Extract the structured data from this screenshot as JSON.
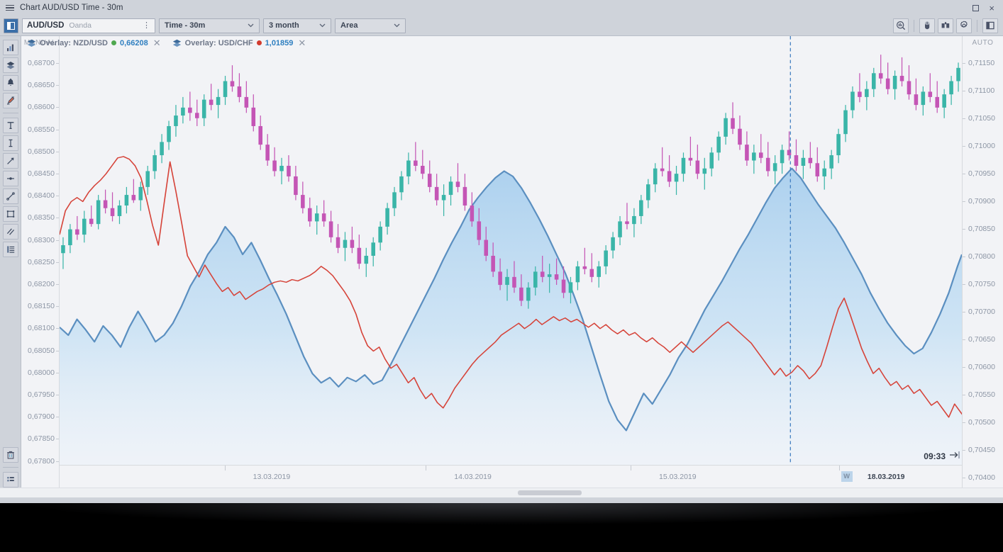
{
  "window": {
    "title": "Chart AUD/USD Time - 30m",
    "menu_icon": "hamburger-icon",
    "maximize_label": "",
    "close_label": "×"
  },
  "toolbar": {
    "panel_toggle_icon": "panel-toggle-icon",
    "symbol": {
      "name": "AUD/USD",
      "source": "Oanda",
      "more_icon": "more-vertical-icon"
    },
    "timeframe": {
      "label": "Time - 30m"
    },
    "range": {
      "label": "3 month"
    },
    "chart_type": {
      "label": "Area"
    },
    "right_buttons": [
      {
        "name": "zoom-mode-icon"
      },
      {
        "name": "mouse-mode-icon"
      },
      {
        "name": "compare-icon"
      },
      {
        "name": "settings-gear-icon"
      },
      {
        "name": "right-panel-icon"
      }
    ]
  },
  "rail": {
    "items": [
      {
        "name": "bar-chart-icon"
      },
      {
        "name": "layers-icon"
      },
      {
        "name": "alert-bell-icon"
      },
      {
        "name": "draw-pencil-icon"
      },
      {
        "name": "text-tool-icon"
      },
      {
        "name": "vertical-line-icon"
      },
      {
        "name": "arrow-tool-icon"
      },
      {
        "name": "horizontal-ray-icon"
      },
      {
        "name": "trend-line-icon"
      },
      {
        "name": "rectangle-icon"
      },
      {
        "name": "parallel-channel-icon"
      },
      {
        "name": "fibonacci-icon"
      }
    ],
    "bottom_items": [
      {
        "name": "trash-icon"
      },
      {
        "name": "objects-list-icon"
      }
    ]
  },
  "overlays": [
    {
      "label": "Overlay: NZD/USD",
      "value": "0,66208",
      "color": "#4fa84f",
      "close_label": "✕",
      "icon": "layers-icon"
    },
    {
      "label": "Overlay: USD/CHF",
      "value": "1,01859",
      "color": "#d23b2e",
      "close_label": "✕",
      "icon": "layers-icon"
    }
  ],
  "axes": {
    "left": {
      "mode_label": "MANUAL",
      "ticks": [
        "0,68700",
        "0,68650",
        "0,68600",
        "0,68550",
        "0,68500",
        "0,68450",
        "0,68400",
        "0,68350",
        "0,68300",
        "0,68250",
        "0,68200",
        "0,68150",
        "0,68100",
        "0,68050",
        "0,68000",
        "0,67950",
        "0,67900",
        "0,67850",
        "0,67800"
      ]
    },
    "right": {
      "mode_label": "AUTO",
      "ticks": [
        "0,71150",
        "0,71100",
        "0,71050",
        "0,71000",
        "0,70950",
        "0,70900",
        "0,70850",
        "0,70800",
        "0,70750",
        "0,70700",
        "0,70650",
        "0,70600",
        "0,70550",
        "0,70500",
        "0,70450",
        "0,70400"
      ]
    },
    "time": {
      "labels": [
        {
          "text": "13.03.2019",
          "x_pct": 23.5,
          "bold": false,
          "week": false
        },
        {
          "text": "14.03.2019",
          "x_pct": 45.8,
          "bold": false,
          "week": false
        },
        {
          "text": "15.03.2019",
          "x_pct": 68.5,
          "bold": false,
          "week": false
        },
        {
          "text": "18.03.2019",
          "x_pct": 91.6,
          "bold": true,
          "week": true,
          "week_badge": "W"
        }
      ]
    }
  },
  "cursor": {
    "time_label": "09:33",
    "jump_icon": "jump-to-now-icon"
  },
  "footer": {
    "zoom_out_label": "—",
    "zoom_in_label": "+"
  },
  "colors": {
    "candle_up": "#3ab5a8",
    "candle_down": "#c455b5",
    "area_stroke": "#5b8fc0",
    "area_fill": "#b9d8f0",
    "line_overlay": "#d6443a",
    "crosshair": "#3c7bbf",
    "chart_bg": "#f2f3f6",
    "chrome": "#cfd3da"
  },
  "chart_data": {
    "type": "line",
    "title": "Chart AUD/USD Time - 30m",
    "xlabel": "",
    "ylabel": "",
    "grid": false,
    "legend_position": "top-left",
    "y_left_range": [
      0.678,
      0.687
    ],
    "y_right_range": [
      0.704,
      0.7115
    ],
    "x_range": [
      "13.03.2019",
      "18.03.2019"
    ],
    "series": [
      {
        "name": "AUD/USD",
        "type": "candlestick",
        "axis": "right",
        "color_up": "#3ab5a8",
        "color_down": "#c455b5",
        "ohlc": [
          [
            0.7079,
            0.7082,
            0.7076,
            0.70805
          ],
          [
            0.70805,
            0.70845,
            0.7079,
            0.70835
          ],
          [
            0.70835,
            0.7086,
            0.70815,
            0.70825
          ],
          [
            0.70825,
            0.7087,
            0.7081,
            0.70855
          ],
          [
            0.70855,
            0.7088,
            0.7084,
            0.70845
          ],
          [
            0.70845,
            0.709,
            0.70835,
            0.7089
          ],
          [
            0.7089,
            0.7091,
            0.70865,
            0.70875
          ],
          [
            0.70875,
            0.70905,
            0.7085,
            0.7086
          ],
          [
            0.7086,
            0.7089,
            0.70845,
            0.7088
          ],
          [
            0.7088,
            0.70915,
            0.70865,
            0.709
          ],
          [
            0.709,
            0.7093,
            0.70885,
            0.7089
          ],
          [
            0.7089,
            0.70925,
            0.7087,
            0.70915
          ],
          [
            0.70915,
            0.70955,
            0.709,
            0.70945
          ],
          [
            0.70945,
            0.70985,
            0.7093,
            0.70975
          ],
          [
            0.70975,
            0.71015,
            0.7096,
            0.71
          ],
          [
            0.71,
            0.7104,
            0.70985,
            0.7103
          ],
          [
            0.7103,
            0.7107,
            0.7101,
            0.7105
          ],
          [
            0.7105,
            0.71085,
            0.71035,
            0.71065
          ],
          [
            0.71065,
            0.71095,
            0.7104,
            0.71055
          ],
          [
            0.71055,
            0.7108,
            0.7103,
            0.71045
          ],
          [
            0.71045,
            0.7109,
            0.7103,
            0.7108
          ],
          [
            0.7108,
            0.7111,
            0.7106,
            0.7107
          ],
          [
            0.7107,
            0.711,
            0.71045,
            0.71085
          ],
          [
            0.71085,
            0.71125,
            0.7107,
            0.71115
          ],
          [
            0.71115,
            0.71145,
            0.71095,
            0.71105
          ],
          [
            0.71105,
            0.7113,
            0.71075,
            0.71085
          ],
          [
            0.71085,
            0.71115,
            0.71055,
            0.71065
          ],
          [
            0.71065,
            0.7109,
            0.7102,
            0.7103
          ],
          [
            0.7103,
            0.7105,
            0.70985,
            0.70995
          ],
          [
            0.70995,
            0.71015,
            0.70955,
            0.70965
          ],
          [
            0.70965,
            0.7099,
            0.70935,
            0.70945
          ],
          [
            0.70945,
            0.7097,
            0.7092,
            0.70955
          ],
          [
            0.70955,
            0.70975,
            0.70925,
            0.70935
          ],
          [
            0.70935,
            0.70955,
            0.7089,
            0.709
          ],
          [
            0.709,
            0.70925,
            0.70865,
            0.70875
          ],
          [
            0.70875,
            0.70895,
            0.7084,
            0.7085
          ],
          [
            0.7085,
            0.7088,
            0.70825,
            0.70865
          ],
          [
            0.70865,
            0.7089,
            0.7084,
            0.7085
          ],
          [
            0.7085,
            0.7087,
            0.7081,
            0.7082
          ],
          [
            0.7082,
            0.70845,
            0.7079,
            0.708
          ],
          [
            0.708,
            0.7083,
            0.70775,
            0.70815
          ],
          [
            0.70815,
            0.7084,
            0.7079,
            0.708
          ],
          [
            0.708,
            0.70825,
            0.7076,
            0.7077
          ],
          [
            0.7077,
            0.708,
            0.70745,
            0.70785
          ],
          [
            0.70785,
            0.7082,
            0.70765,
            0.7081
          ],
          [
            0.7081,
            0.7085,
            0.70795,
            0.7084
          ],
          [
            0.7084,
            0.70885,
            0.70825,
            0.70875
          ],
          [
            0.70875,
            0.70915,
            0.7086,
            0.70905
          ],
          [
            0.70905,
            0.70945,
            0.7089,
            0.70935
          ],
          [
            0.70935,
            0.7098,
            0.7092,
            0.70965
          ],
          [
            0.70965,
            0.71,
            0.70945,
            0.70955
          ],
          [
            0.70955,
            0.70985,
            0.7093,
            0.7094
          ],
          [
            0.7094,
            0.70965,
            0.70905,
            0.70915
          ],
          [
            0.70915,
            0.7094,
            0.7088,
            0.7089
          ],
          [
            0.7089,
            0.7092,
            0.7086,
            0.709
          ],
          [
            0.709,
            0.70935,
            0.7088,
            0.70925
          ],
          [
            0.70925,
            0.7096,
            0.70905,
            0.70915
          ],
          [
            0.70915,
            0.7094,
            0.7087,
            0.7088
          ],
          [
            0.7088,
            0.70905,
            0.7084,
            0.7085
          ],
          [
            0.7085,
            0.70875,
            0.70805,
            0.70815
          ],
          [
            0.70815,
            0.7084,
            0.70775,
            0.70785
          ],
          [
            0.70785,
            0.7081,
            0.70745,
            0.70755
          ],
          [
            0.70755,
            0.7078,
            0.7072,
            0.7073
          ],
          [
            0.7073,
            0.7076,
            0.707,
            0.70745
          ],
          [
            0.70745,
            0.70775,
            0.70715,
            0.70725
          ],
          [
            0.70725,
            0.7075,
            0.7069,
            0.707
          ],
          [
            0.707,
            0.70735,
            0.70685,
            0.70725
          ],
          [
            0.70725,
            0.70765,
            0.7071,
            0.70755
          ],
          [
            0.70755,
            0.70785,
            0.70735,
            0.70745
          ],
          [
            0.70745,
            0.7077,
            0.70715,
            0.7075
          ],
          [
            0.7075,
            0.7078,
            0.7073,
            0.7074
          ],
          [
            0.7074,
            0.70765,
            0.70705,
            0.70715
          ],
          [
            0.70715,
            0.70745,
            0.70695,
            0.70735
          ],
          [
            0.70735,
            0.70775,
            0.7072,
            0.70765
          ],
          [
            0.70765,
            0.708,
            0.7075,
            0.7076
          ],
          [
            0.7076,
            0.7079,
            0.70735,
            0.70745
          ],
          [
            0.70745,
            0.70775,
            0.70725,
            0.70765
          ],
          [
            0.70765,
            0.70805,
            0.7075,
            0.70795
          ],
          [
            0.70795,
            0.7083,
            0.7078,
            0.7082
          ],
          [
            0.7082,
            0.7086,
            0.70805,
            0.7085
          ],
          [
            0.7085,
            0.70885,
            0.70835,
            0.70845
          ],
          [
            0.70845,
            0.70875,
            0.7082,
            0.7086
          ],
          [
            0.7086,
            0.709,
            0.70845,
            0.7089
          ],
          [
            0.7089,
            0.7093,
            0.70875,
            0.7092
          ],
          [
            0.7092,
            0.7096,
            0.70905,
            0.7095
          ],
          [
            0.7095,
            0.7099,
            0.70935,
            0.70945
          ],
          [
            0.70945,
            0.70975,
            0.70915,
            0.70925
          ],
          [
            0.70925,
            0.70955,
            0.709,
            0.7094
          ],
          [
            0.7094,
            0.7098,
            0.70925,
            0.7097
          ],
          [
            0.7097,
            0.7101,
            0.70955,
            0.70965
          ],
          [
            0.70965,
            0.70995,
            0.7093,
            0.7094
          ],
          [
            0.7094,
            0.7097,
            0.7091,
            0.7095
          ],
          [
            0.7095,
            0.7099,
            0.70935,
            0.7098
          ],
          [
            0.7098,
            0.7102,
            0.70965,
            0.7101
          ],
          [
            0.7101,
            0.71055,
            0.70995,
            0.71045
          ],
          [
            0.71045,
            0.71075,
            0.71015,
            0.71025
          ],
          [
            0.71025,
            0.7105,
            0.70985,
            0.70995
          ],
          [
            0.70995,
            0.7102,
            0.70955,
            0.70965
          ],
          [
            0.70965,
            0.70995,
            0.7094,
            0.7098
          ],
          [
            0.7098,
            0.71015,
            0.7096,
            0.7097
          ],
          [
            0.7097,
            0.71,
            0.70935,
            0.70945
          ],
          [
            0.70945,
            0.70975,
            0.7092,
            0.7096
          ],
          [
            0.7096,
            0.70995,
            0.7094,
            0.70985
          ],
          [
            0.70985,
            0.7102,
            0.70965,
            0.70975
          ],
          [
            0.70975,
            0.71005,
            0.70945,
            0.70955
          ],
          [
            0.70955,
            0.70985,
            0.7093,
            0.7097
          ],
          [
            0.7097,
            0.71,
            0.7095,
            0.7096
          ],
          [
            0.7096,
            0.7099,
            0.70925,
            0.70935
          ],
          [
            0.70935,
            0.70965,
            0.7091,
            0.7095
          ],
          [
            0.7095,
            0.70985,
            0.7093,
            0.70975
          ],
          [
            0.70975,
            0.71025,
            0.7096,
            0.71015
          ],
          [
            0.71015,
            0.7107,
            0.71,
            0.7106
          ],
          [
            0.7106,
            0.71105,
            0.71045,
            0.71095
          ],
          [
            0.71095,
            0.7113,
            0.71075,
            0.71085
          ],
          [
            0.71085,
            0.71115,
            0.7106,
            0.711
          ],
          [
            0.711,
            0.7114,
            0.71085,
            0.7113
          ],
          [
            0.7113,
            0.71165,
            0.7111,
            0.7112
          ],
          [
            0.7112,
            0.7115,
            0.7109,
            0.711
          ],
          [
            0.711,
            0.71135,
            0.7108,
            0.71125
          ],
          [
            0.71125,
            0.7116,
            0.71105,
            0.71115
          ],
          [
            0.71115,
            0.71145,
            0.7108,
            0.7109
          ],
          [
            0.7109,
            0.7112,
            0.7106,
            0.7107
          ],
          [
            0.7107,
            0.71105,
            0.7105,
            0.71095
          ],
          [
            0.71095,
            0.7113,
            0.71075,
            0.71085
          ],
          [
            0.71085,
            0.71115,
            0.71055,
            0.71065
          ],
          [
            0.71065,
            0.711,
            0.71045,
            0.7109
          ],
          [
            0.7109,
            0.71125,
            0.7107,
            0.71115
          ],
          [
            0.71115,
            0.7115,
            0.71095,
            0.7114
          ]
        ]
      },
      {
        "name": "Overlay: NZD/USD",
        "type": "area",
        "axis": "left",
        "color": "#5b8fc0",
        "fill": "#b9d8f0",
        "last_value": "0,66208"
      },
      {
        "name": "Overlay: USD/CHF",
        "type": "line",
        "axis": "left",
        "color": "#d6443a",
        "last_value": "1,01859"
      }
    ]
  }
}
